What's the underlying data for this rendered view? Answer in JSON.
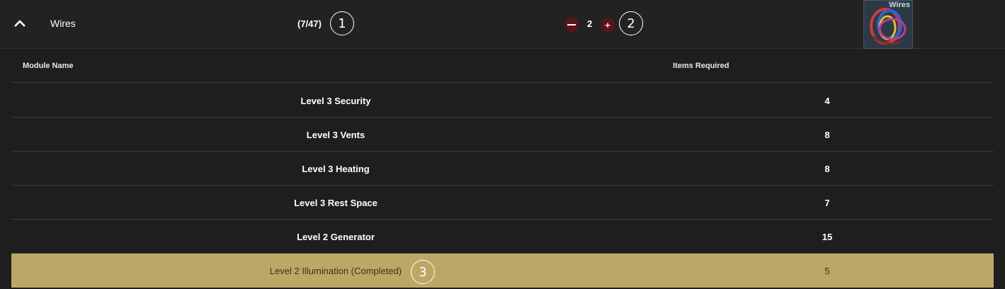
{
  "header": {
    "title": "Wires",
    "count": "(7/47)",
    "annotation_1": "1",
    "minus_label": "—",
    "quantity": "2",
    "plus_label": "+",
    "annotation_2": "2",
    "thumbnail_label": "Wires",
    "minus_color": "#5a1414"
  },
  "table": {
    "columns": [
      "Module Name",
      "Items Required"
    ],
    "rows": [
      {
        "name": "Level 3 Security",
        "items": "4",
        "completed": false
      },
      {
        "name": "Level 3 Vents",
        "items": "8",
        "completed": false
      },
      {
        "name": "Level 3 Heating",
        "items": "8",
        "completed": false
      },
      {
        "name": "Level 3 Rest Space",
        "items": "7",
        "completed": false
      },
      {
        "name": "Level 2 Generator",
        "items": "15",
        "completed": false
      },
      {
        "name": "Level 2 Illumination (Completed)",
        "items": "5",
        "completed": true
      }
    ],
    "annotation_3": "3",
    "completed_color": "#bca767"
  },
  "icons": [
    "chevron-up-icon",
    "minus-icon",
    "plus-icon",
    "wires-thumbnail-icon"
  ]
}
